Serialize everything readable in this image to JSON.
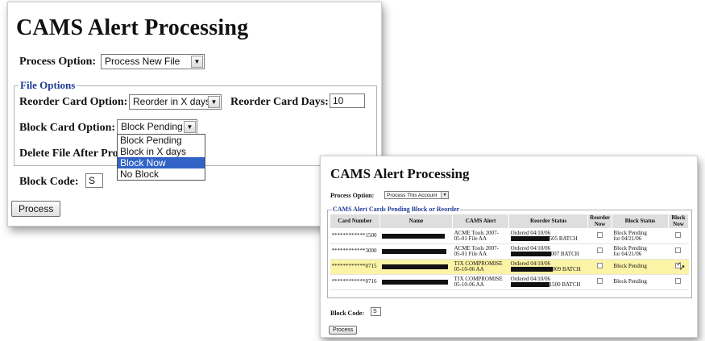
{
  "left_window": {
    "title": "CAMS Alert Processing",
    "process_option": {
      "label": "Process Option:",
      "value": "Process New File"
    },
    "file_options": {
      "legend": "File Options",
      "reorder_card_option": {
        "label": "Reorder Card Option:",
        "value": "Reorder in X days"
      },
      "reorder_card_days": {
        "label": "Reorder Card Days:",
        "value": "10"
      },
      "block_card_option": {
        "label": "Block Card Option:",
        "value": "Block Pending",
        "options": [
          "Block Pending",
          "Block in X days",
          "Block Now",
          "No Block"
        ],
        "highlighted": "Block Now"
      },
      "delete_file_label": "Delete File After Pro"
    },
    "block_code": {
      "label": "Block Code:",
      "value": "S"
    },
    "process_button": "Process"
  },
  "right_window": {
    "title": "CAMS Alert Processing",
    "process_option": {
      "label": "Process Option:",
      "value": "Process This Account"
    },
    "legend": "CAMS Alert Cards Pending Block or Reorder",
    "columns": [
      "Card Number",
      "Name",
      "CAMS Alert",
      "Reorder Status",
      "Reorder Now",
      "Block Status",
      "Block Now"
    ],
    "rows": [
      {
        "card": "************1500",
        "alert_1": "ACME Tools 2007-",
        "alert_2": "05-01 File AA",
        "status_1": "Ordered 04/10/06",
        "status_2": "505 BATCH",
        "block_1": "Block Pending",
        "block_2": "for 04/21/06",
        "block_now": false,
        "highlight": false
      },
      {
        "card": "************3000",
        "alert_1": "ACME Tools 2007-",
        "alert_2": "05-01 File AA",
        "status_1": "Ordered 04/10/06",
        "status_2": "007 BATCH",
        "block_1": "Block Pending",
        "block_2": "for 04/21/06",
        "block_now": false,
        "highlight": false
      },
      {
        "card": "************0715",
        "alert_1": "TJX COMPROMISE",
        "alert_2": "05-10-06 AA",
        "status_1": "Ordered 04/10/06",
        "status_2": "009 BATCH",
        "block_1": "Block Pending",
        "block_2": "",
        "block_now": true,
        "highlight": true
      },
      {
        "card": "************0716",
        "alert_1": "TJX COMPROMISE",
        "alert_2": "05-10-06 AA",
        "status_1": "Ordered 04/10/06",
        "status_2": "1500 BATCH",
        "block_1": "Block Pending",
        "block_2": "",
        "block_now": false,
        "highlight": false
      }
    ],
    "block_code": {
      "label": "Block Code:",
      "value": "S"
    },
    "process_button": "Process"
  }
}
